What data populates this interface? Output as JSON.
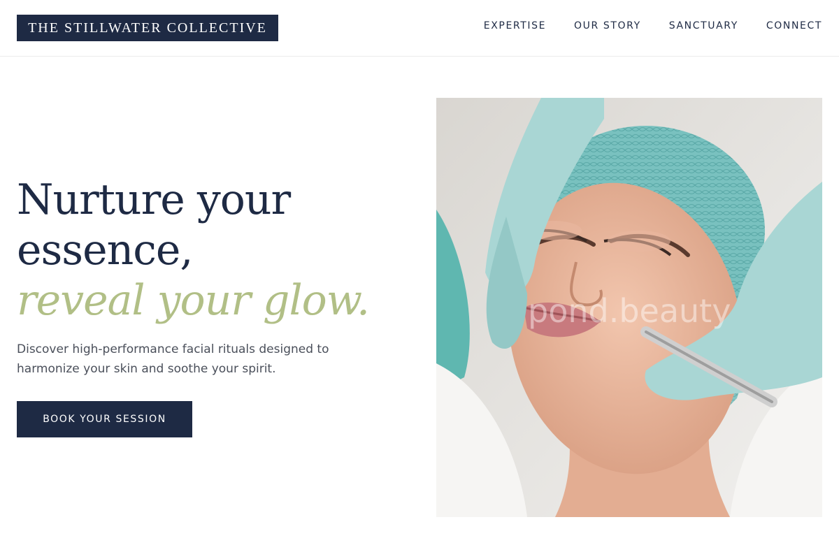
{
  "header": {
    "logo": "THE STILLWATER COLLECTIVE",
    "nav": [
      "EXPERTISE",
      "OUR STORY",
      "SANCTUARY",
      "CONNECT"
    ]
  },
  "hero": {
    "headline_line1": "Nurture your",
    "headline_line2": "essence,",
    "headline_accent": "reveal your glow.",
    "subcopy": "Discover high-performance facial rituals designed to harmonize your skin and soothe your spirit.",
    "cta_label": "BOOK YOUR SESSION",
    "image_watermark": "pond.beauty"
  },
  "colors": {
    "navy": "#1e2a44",
    "sage": "#b1bf86",
    "glove_teal": "#a9d6d4",
    "cap_teal": "#7cc2c0"
  }
}
